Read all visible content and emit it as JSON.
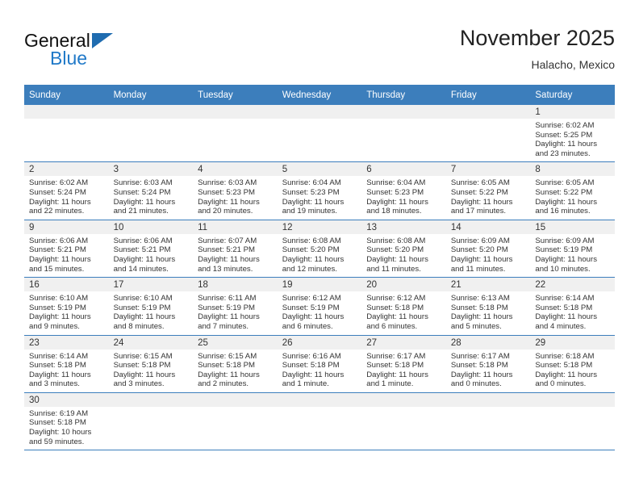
{
  "brand": {
    "name_part1": "General",
    "name_part2": "Blue",
    "accent_color": "#2079c8",
    "logo_triangle_color": "#1f6cb0"
  },
  "header": {
    "title": "November 2025",
    "subtitle": "Halacho, Mexico"
  },
  "theme": {
    "header_row_bg": "#3c7ebc",
    "daynum_strip_bg": "#f0f0f0",
    "row_divider": "#3c7ebc",
    "text": "#333333"
  },
  "columns": [
    "Sunday",
    "Monday",
    "Tuesday",
    "Wednesday",
    "Thursday",
    "Friday",
    "Saturday"
  ],
  "weeks": [
    [
      {
        "day": "",
        "lines": []
      },
      {
        "day": "",
        "lines": []
      },
      {
        "day": "",
        "lines": []
      },
      {
        "day": "",
        "lines": []
      },
      {
        "day": "",
        "lines": []
      },
      {
        "day": "",
        "lines": []
      },
      {
        "day": "1",
        "lines": [
          "Sunrise: 6:02 AM",
          "Sunset: 5:25 PM",
          "Daylight: 11 hours",
          "and 23 minutes."
        ]
      }
    ],
    [
      {
        "day": "2",
        "lines": [
          "Sunrise: 6:02 AM",
          "Sunset: 5:24 PM",
          "Daylight: 11 hours",
          "and 22 minutes."
        ]
      },
      {
        "day": "3",
        "lines": [
          "Sunrise: 6:03 AM",
          "Sunset: 5:24 PM",
          "Daylight: 11 hours",
          "and 21 minutes."
        ]
      },
      {
        "day": "4",
        "lines": [
          "Sunrise: 6:03 AM",
          "Sunset: 5:23 PM",
          "Daylight: 11 hours",
          "and 20 minutes."
        ]
      },
      {
        "day": "5",
        "lines": [
          "Sunrise: 6:04 AM",
          "Sunset: 5:23 PM",
          "Daylight: 11 hours",
          "and 19 minutes."
        ]
      },
      {
        "day": "6",
        "lines": [
          "Sunrise: 6:04 AM",
          "Sunset: 5:23 PM",
          "Daylight: 11 hours",
          "and 18 minutes."
        ]
      },
      {
        "day": "7",
        "lines": [
          "Sunrise: 6:05 AM",
          "Sunset: 5:22 PM",
          "Daylight: 11 hours",
          "and 17 minutes."
        ]
      },
      {
        "day": "8",
        "lines": [
          "Sunrise: 6:05 AM",
          "Sunset: 5:22 PM",
          "Daylight: 11 hours",
          "and 16 minutes."
        ]
      }
    ],
    [
      {
        "day": "9",
        "lines": [
          "Sunrise: 6:06 AM",
          "Sunset: 5:21 PM",
          "Daylight: 11 hours",
          "and 15 minutes."
        ]
      },
      {
        "day": "10",
        "lines": [
          "Sunrise: 6:06 AM",
          "Sunset: 5:21 PM",
          "Daylight: 11 hours",
          "and 14 minutes."
        ]
      },
      {
        "day": "11",
        "lines": [
          "Sunrise: 6:07 AM",
          "Sunset: 5:21 PM",
          "Daylight: 11 hours",
          "and 13 minutes."
        ]
      },
      {
        "day": "12",
        "lines": [
          "Sunrise: 6:08 AM",
          "Sunset: 5:20 PM",
          "Daylight: 11 hours",
          "and 12 minutes."
        ]
      },
      {
        "day": "13",
        "lines": [
          "Sunrise: 6:08 AM",
          "Sunset: 5:20 PM",
          "Daylight: 11 hours",
          "and 11 minutes."
        ]
      },
      {
        "day": "14",
        "lines": [
          "Sunrise: 6:09 AM",
          "Sunset: 5:20 PM",
          "Daylight: 11 hours",
          "and 11 minutes."
        ]
      },
      {
        "day": "15",
        "lines": [
          "Sunrise: 6:09 AM",
          "Sunset: 5:19 PM",
          "Daylight: 11 hours",
          "and 10 minutes."
        ]
      }
    ],
    [
      {
        "day": "16",
        "lines": [
          "Sunrise: 6:10 AM",
          "Sunset: 5:19 PM",
          "Daylight: 11 hours",
          "and 9 minutes."
        ]
      },
      {
        "day": "17",
        "lines": [
          "Sunrise: 6:10 AM",
          "Sunset: 5:19 PM",
          "Daylight: 11 hours",
          "and 8 minutes."
        ]
      },
      {
        "day": "18",
        "lines": [
          "Sunrise: 6:11 AM",
          "Sunset: 5:19 PM",
          "Daylight: 11 hours",
          "and 7 minutes."
        ]
      },
      {
        "day": "19",
        "lines": [
          "Sunrise: 6:12 AM",
          "Sunset: 5:19 PM",
          "Daylight: 11 hours",
          "and 6 minutes."
        ]
      },
      {
        "day": "20",
        "lines": [
          "Sunrise: 6:12 AM",
          "Sunset: 5:18 PM",
          "Daylight: 11 hours",
          "and 6 minutes."
        ]
      },
      {
        "day": "21",
        "lines": [
          "Sunrise: 6:13 AM",
          "Sunset: 5:18 PM",
          "Daylight: 11 hours",
          "and 5 minutes."
        ]
      },
      {
        "day": "22",
        "lines": [
          "Sunrise: 6:14 AM",
          "Sunset: 5:18 PM",
          "Daylight: 11 hours",
          "and 4 minutes."
        ]
      }
    ],
    [
      {
        "day": "23",
        "lines": [
          "Sunrise: 6:14 AM",
          "Sunset: 5:18 PM",
          "Daylight: 11 hours",
          "and 3 minutes."
        ]
      },
      {
        "day": "24",
        "lines": [
          "Sunrise: 6:15 AM",
          "Sunset: 5:18 PM",
          "Daylight: 11 hours",
          "and 3 minutes."
        ]
      },
      {
        "day": "25",
        "lines": [
          "Sunrise: 6:15 AM",
          "Sunset: 5:18 PM",
          "Daylight: 11 hours",
          "and 2 minutes."
        ]
      },
      {
        "day": "26",
        "lines": [
          "Sunrise: 6:16 AM",
          "Sunset: 5:18 PM",
          "Daylight: 11 hours",
          "and 1 minute."
        ]
      },
      {
        "day": "27",
        "lines": [
          "Sunrise: 6:17 AM",
          "Sunset: 5:18 PM",
          "Daylight: 11 hours",
          "and 1 minute."
        ]
      },
      {
        "day": "28",
        "lines": [
          "Sunrise: 6:17 AM",
          "Sunset: 5:18 PM",
          "Daylight: 11 hours",
          "and 0 minutes."
        ]
      },
      {
        "day": "29",
        "lines": [
          "Sunrise: 6:18 AM",
          "Sunset: 5:18 PM",
          "Daylight: 11 hours",
          "and 0 minutes."
        ]
      }
    ],
    [
      {
        "day": "30",
        "lines": [
          "Sunrise: 6:19 AM",
          "Sunset: 5:18 PM",
          "Daylight: 10 hours",
          "and 59 minutes."
        ]
      },
      {
        "day": "",
        "lines": []
      },
      {
        "day": "",
        "lines": []
      },
      {
        "day": "",
        "lines": []
      },
      {
        "day": "",
        "lines": []
      },
      {
        "day": "",
        "lines": []
      },
      {
        "day": "",
        "lines": []
      }
    ]
  ]
}
